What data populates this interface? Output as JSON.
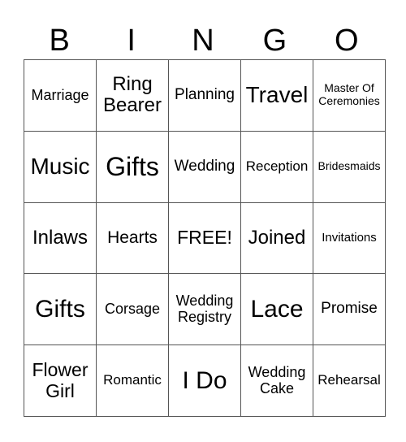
{
  "header": [
    "B",
    "I",
    "N",
    "G",
    "O"
  ],
  "rows": [
    [
      "Marriage",
      "Ring Bearer",
      "Planning",
      "Travel",
      "Master Of Ceremonies"
    ],
    [
      "Music",
      "Gifts",
      "Wedding",
      "Reception",
      "Bridesmaids"
    ],
    [
      "Inlaws",
      "Hearts",
      "FREE!",
      "Joined",
      "Invitations"
    ],
    [
      "Gifts",
      "Corsage",
      "Wedding Registry",
      "Lace",
      "Promise"
    ],
    [
      "Flower Girl",
      "Romantic",
      "I Do",
      "Wedding Cake",
      "Rehearsal"
    ]
  ]
}
